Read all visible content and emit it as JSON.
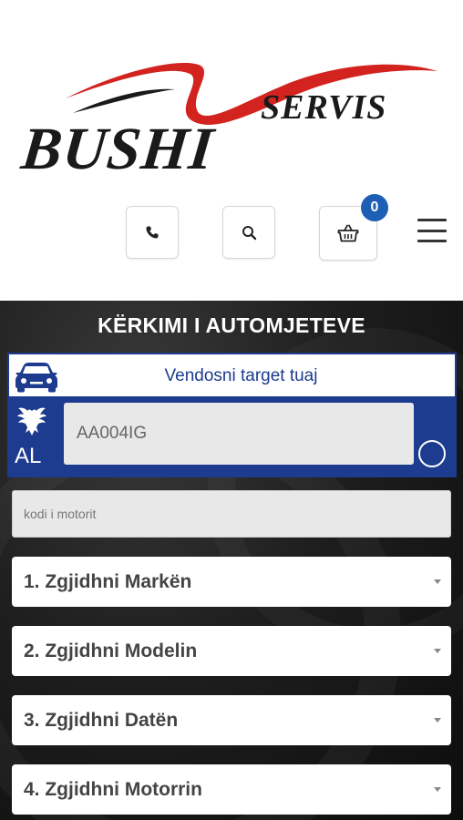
{
  "logo": {
    "brand": "BUSHI",
    "sub": "SERVIS",
    "swoosh_color": "#d2231f"
  },
  "header": {
    "phone_icon": "phone-icon",
    "search_icon": "search-icon",
    "cart_icon": "basket-icon",
    "cart_count": "0",
    "menu_icon": "hamburger-icon",
    "badge_color": "#1d5fb4"
  },
  "search": {
    "title": "KËRKIMI I AUTOMJETEVE",
    "plate_hint": "Vendosni target tuaj",
    "country_code": "AL",
    "plate_value": "AA004IG",
    "engine_placeholder": "kodi i motorit",
    "selects": [
      {
        "label": "1. Zgjidhni Markën"
      },
      {
        "label": "2. Zgjidhni Modelin"
      },
      {
        "label": "3. Zgjidhni Datën"
      },
      {
        "label": "4. Zgjidhni Motorrin"
      }
    ],
    "plate_color": "#1d3b8f"
  }
}
